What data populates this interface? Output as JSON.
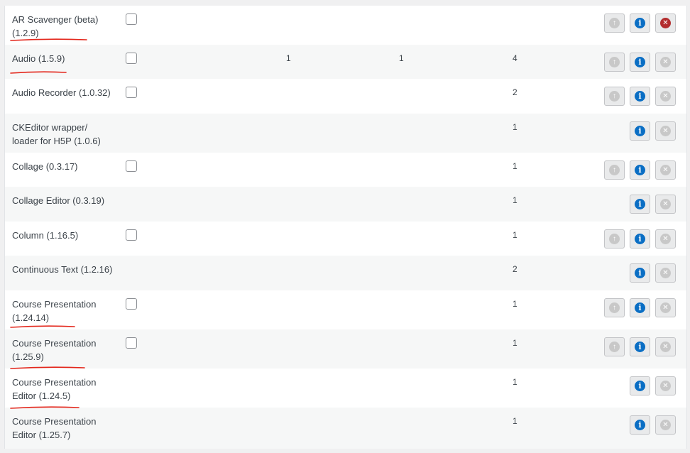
{
  "libraries": [
    {
      "title": "AR Scavenger (beta) (1.2.9)",
      "line1": "AR Scavenger (beta)",
      "line2": "(1.2.9)",
      "has_checkbox": true,
      "c1": "",
      "c2": "",
      "c3": "",
      "has_upgrade": true,
      "delete_enabled": true
    },
    {
      "title": "Audio (1.5.9)",
      "line1": "Audio (1.5.9)",
      "line2": "",
      "has_checkbox": true,
      "c1": "1",
      "c2": "1",
      "c3": "4",
      "has_upgrade": true,
      "delete_enabled": false
    },
    {
      "title": "Audio Recorder (1.0.32)",
      "line1": "Audio Recorder (1.0.32)",
      "line2": "",
      "has_checkbox": true,
      "c1": "",
      "c2": "",
      "c3": "2",
      "has_upgrade": true,
      "delete_enabled": false
    },
    {
      "title": "CKEditor wrapper/ loader for H5P (1.0.6)",
      "line1": "CKEditor wrapper/",
      "line2": "loader for H5P (1.0.6)",
      "has_checkbox": false,
      "c1": "",
      "c2": "",
      "c3": "1",
      "has_upgrade": false,
      "delete_enabled": false
    },
    {
      "title": "Collage (0.3.17)",
      "line1": "Collage (0.3.17)",
      "line2": "",
      "has_checkbox": true,
      "c1": "",
      "c2": "",
      "c3": "1",
      "has_upgrade": true,
      "delete_enabled": false
    },
    {
      "title": "Collage Editor (0.3.19)",
      "line1": "Collage Editor (0.3.19)",
      "line2": "",
      "has_checkbox": false,
      "c1": "",
      "c2": "",
      "c3": "1",
      "has_upgrade": false,
      "delete_enabled": false
    },
    {
      "title": "Column (1.16.5)",
      "line1": "Column (1.16.5)",
      "line2": "",
      "has_checkbox": true,
      "c1": "",
      "c2": "",
      "c3": "1",
      "has_upgrade": true,
      "delete_enabled": false
    },
    {
      "title": "Continuous Text (1.2.16)",
      "line1": "Continuous Text (1.2.16)",
      "line2": "",
      "has_checkbox": false,
      "c1": "",
      "c2": "",
      "c3": "2",
      "has_upgrade": false,
      "delete_enabled": false
    },
    {
      "title": "Course Presentation (1.24.14)",
      "line1": "Course Presentation",
      "line2": "(1.24.14)",
      "has_checkbox": true,
      "c1": "",
      "c2": "",
      "c3": "1",
      "has_upgrade": true,
      "delete_enabled": false
    },
    {
      "title": "Course Presentation (1.25.9)",
      "line1": "Course Presentation",
      "line2": "(1.25.9)",
      "has_checkbox": true,
      "c1": "",
      "c2": "",
      "c3": "1",
      "has_upgrade": true,
      "delete_enabled": false
    },
    {
      "title": "Course Presentation Editor (1.24.5)",
      "line1": "Course Presentation",
      "line2": "Editor (1.24.5)",
      "has_checkbox": false,
      "c1": "",
      "c2": "",
      "c3": "1",
      "has_upgrade": false,
      "delete_enabled": false
    },
    {
      "title": "Course Presentation Editor (1.25.7)",
      "line1": "Course Presentation",
      "line2": "Editor (1.25.7)",
      "has_checkbox": false,
      "c1": "",
      "c2": "",
      "c3": "1",
      "has_upgrade": false,
      "delete_enabled": false
    }
  ],
  "icons": {
    "upgrade": "upgrade-arrow-icon",
    "info": "info-icon",
    "delete": "delete-x-icon"
  },
  "colors": {
    "info_blue": "#0a6ec4",
    "delete_red": "#b32d2e",
    "annotation_red": "#e3261b",
    "disabled_gray": "#c8c8c8"
  }
}
